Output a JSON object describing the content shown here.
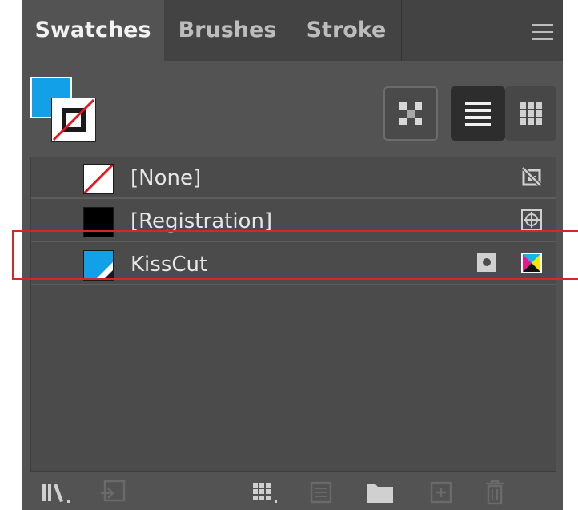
{
  "tabs": [
    {
      "label": "Swatches",
      "active": true
    },
    {
      "label": "Brushes",
      "active": false
    },
    {
      "label": "Stroke",
      "active": false
    }
  ],
  "panel_menu_icon": "hamburger-menu-icon",
  "fill_stroke": {
    "fill_color": "#12a0e8",
    "stroke": "none"
  },
  "view_buttons": [
    {
      "icon": "show-all-swatches-icon",
      "selected": false
    },
    {
      "icon": "list-view-icon",
      "selected": true
    },
    {
      "icon": "thumbnail-view-icon",
      "selected": false
    }
  ],
  "swatches": [
    {
      "name": "[None]",
      "color": "none",
      "indicators": [
        "cannot-edit-icon"
      ]
    },
    {
      "name": "[Registration]",
      "color": "#000000",
      "indicators": [
        "registration-icon"
      ]
    },
    {
      "name": "KissCut",
      "color": "#12a0e8",
      "indicators": [
        "spot-color-icon",
        "cmyk-icon"
      ]
    }
  ],
  "bottom_toolbar": [
    "swatch-libraries-menu-icon",
    "place-swatch-icon",
    "show-swatch-kinds-menu-icon",
    "swatch-options-icon",
    "new-color-group-icon",
    "new-swatch-icon",
    "delete-swatch-icon"
  ],
  "colors": {
    "panel_bg": "#535353",
    "tab_bar_bg": "#434343",
    "list_bg": "#4b4b4b",
    "accent_blue": "#12a0e8",
    "highlight_red": "#d6262a"
  }
}
